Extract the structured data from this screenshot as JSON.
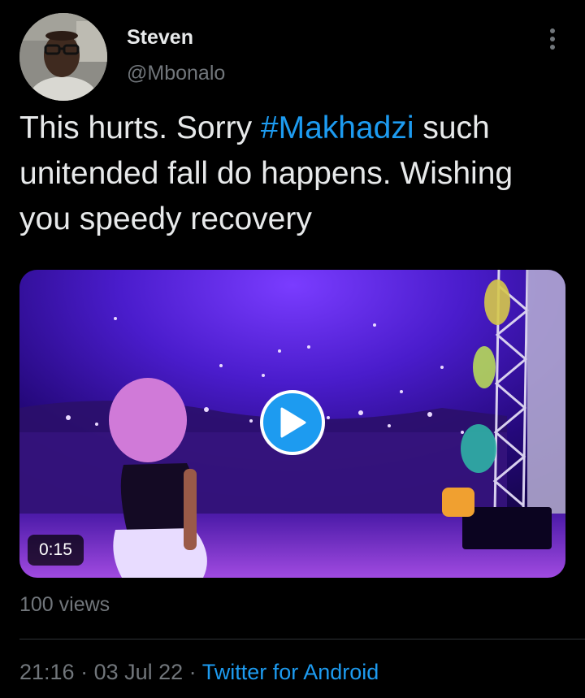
{
  "author": {
    "name": "Steven",
    "handle": "@Mbonalo",
    "avatar_icon": "profile-photo"
  },
  "more_icon": "vertical-ellipsis-icon",
  "tweet": {
    "text_part1": "This hurts. Sorry ",
    "hashtag": "#Makhadzi",
    "text_part2": " such unitended fall do happens. Wishing you speedy recovery"
  },
  "media": {
    "type": "video",
    "duration": "0:15",
    "play_icon": "play-icon"
  },
  "views": "100 views",
  "meta": {
    "time": "21:16",
    "separator1": " · ",
    "date": "03 Jul 22",
    "separator2": " · ",
    "source": "Twitter for Android"
  },
  "colors": {
    "background": "#000000",
    "text": "#e7e9ea",
    "secondary": "#71767b",
    "accent": "#1d9bf0",
    "divider": "#2f3336"
  }
}
